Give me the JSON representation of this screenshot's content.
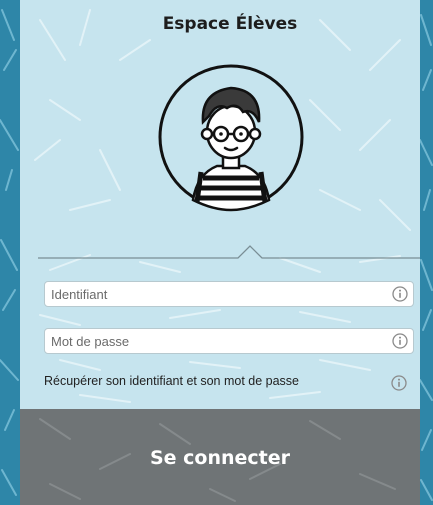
{
  "header": {
    "title": "Espace Élèves"
  },
  "avatar": {
    "icon": "student-avatar-icon"
  },
  "form": {
    "identifiant_placeholder": "Identifiant",
    "password_placeholder": "Mot de passe",
    "info_icon": "info-icon"
  },
  "recover": {
    "label": "Récupérer son identifiant et son mot de passe"
  },
  "connect": {
    "label": "Se connecter"
  },
  "colors": {
    "background": "#2e86a8",
    "panel": "#c6e4ee",
    "button": "#6f7476",
    "button_text": "#ffffff"
  }
}
